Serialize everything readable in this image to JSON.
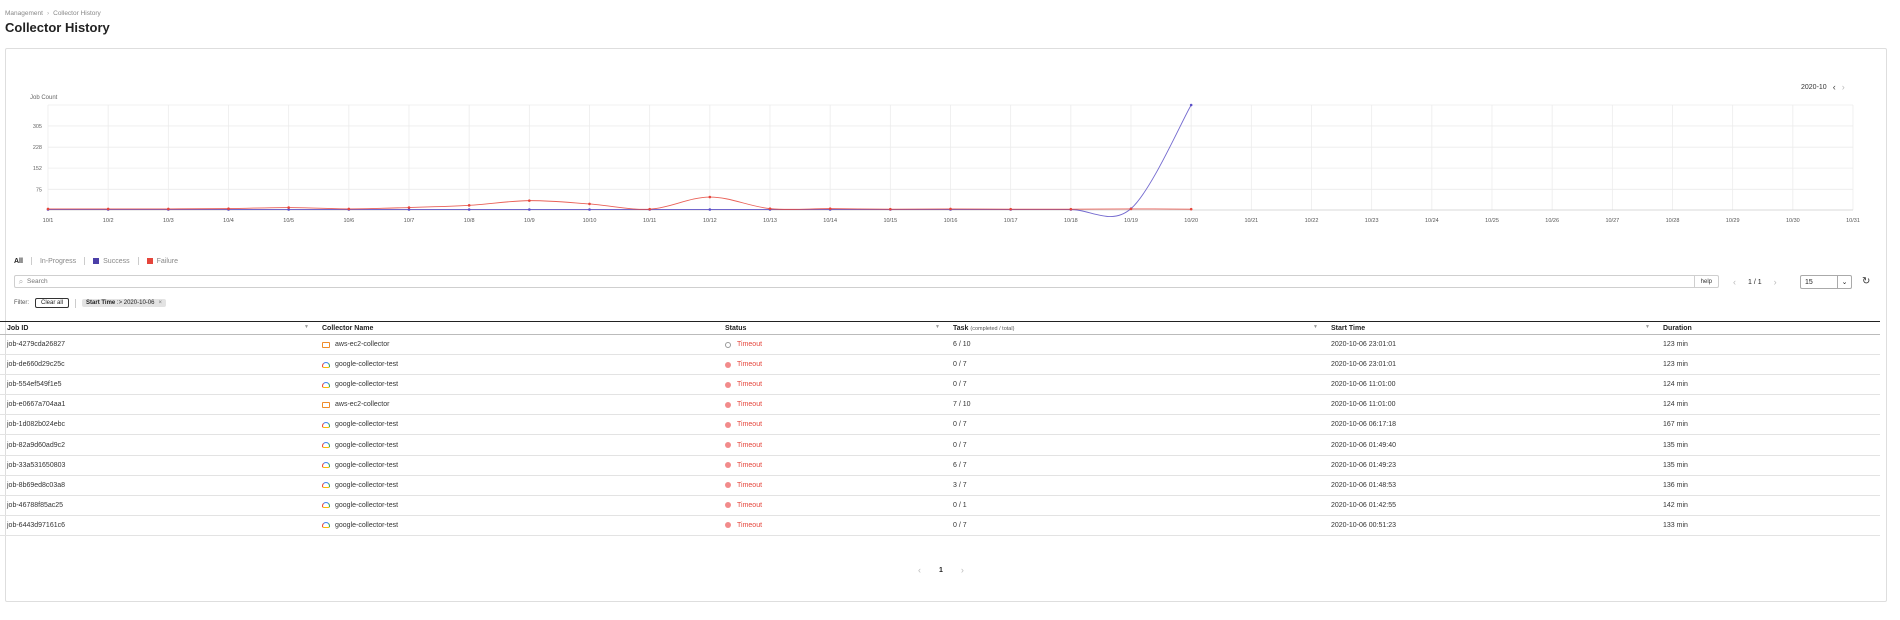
{
  "breadcrumb": [
    "Management",
    "Collector History"
  ],
  "page_title": "Collector History",
  "month_nav": {
    "label": "2020-10",
    "prev_icon": "chevron-left-icon",
    "next_icon": "chevron-right-icon"
  },
  "chart_data": {
    "type": "line",
    "ylabel": "Job Count",
    "yticks": [
      75,
      152,
      228,
      305
    ],
    "ylim": [
      0,
      381
    ],
    "x": [
      "10/1",
      "10/2",
      "10/3",
      "10/4",
      "10/5",
      "10/6",
      "10/7",
      "10/8",
      "10/9",
      "10/10",
      "10/11",
      "10/12",
      "10/13",
      "10/14",
      "10/15",
      "10/16",
      "10/17",
      "10/18",
      "10/19",
      "10/20",
      "10/21",
      "10/22",
      "10/23",
      "10/24",
      "10/25",
      "10/26",
      "10/27",
      "10/28",
      "10/29",
      "10/30",
      "10/31"
    ],
    "series": [
      {
        "key": "success",
        "color": "#5b4fc7",
        "values": [
          0,
          0,
          0,
          0,
          0,
          0,
          0,
          0,
          0,
          0,
          0,
          0,
          0,
          0,
          0,
          0,
          0,
          0,
          5,
          381
        ]
      },
      {
        "key": "failure",
        "color": "#e5453b",
        "values": [
          4,
          4,
          4,
          5,
          9,
          4,
          9,
          17,
          34,
          22,
          3,
          47,
          5,
          5,
          3,
          4,
          3,
          3,
          4,
          3
        ]
      }
    ],
    "grid": true
  },
  "legend": {
    "all": "All",
    "in_progress": "In-Progress",
    "success": "Success",
    "failure": "Failure",
    "success_color": "#4b3fa8",
    "failure_color": "#e5453b"
  },
  "search": {
    "placeholder": "Search",
    "help": "help",
    "icon": "search-icon"
  },
  "pager": {
    "page": "1 / 1",
    "page_size": "15",
    "current": "1"
  },
  "filter": {
    "label": "Filter:",
    "clear_all": "Clear all",
    "tag_key": "Start Time",
    "tag_value": ":> 2020-10-06"
  },
  "table": {
    "headers": {
      "job_id": "Job ID",
      "collector_name": "Collector Name",
      "status": "Status",
      "task": "Task",
      "task_sub": "(completed / total)",
      "start_time": "Start Time",
      "duration": "Duration"
    },
    "rows": [
      {
        "job_id": "job-4279cda26827",
        "provider": "aws",
        "collector": "aws-ec2-collector",
        "status": "Timeout",
        "task": "6 / 10",
        "start": "2020-10-06 23:01:01",
        "duration": "123 min"
      },
      {
        "job_id": "job-de660d29c25c",
        "provider": "google",
        "collector": "google-collector-test",
        "status": "Timeout",
        "task": "0 / 7",
        "start": "2020-10-06 23:01:01",
        "duration": "123 min"
      },
      {
        "job_id": "job-554ef549f1e5",
        "provider": "google",
        "collector": "google-collector-test",
        "status": "Timeout",
        "task": "0 / 7",
        "start": "2020-10-06 11:01:00",
        "duration": "124 min"
      },
      {
        "job_id": "job-e0667a704aa1",
        "provider": "aws",
        "collector": "aws-ec2-collector",
        "status": "Timeout",
        "task": "7 / 10",
        "start": "2020-10-06 11:01:00",
        "duration": "124 min"
      },
      {
        "job_id": "job-1d082b024ebc",
        "provider": "google",
        "collector": "google-collector-test",
        "status": "Timeout",
        "task": "0 / 7",
        "start": "2020-10-06 06:17:18",
        "duration": "167 min"
      },
      {
        "job_id": "job-82a9d60ad9c2",
        "provider": "google",
        "collector": "google-collector-test",
        "status": "Timeout",
        "task": "0 / 7",
        "start": "2020-10-06 01:49:40",
        "duration": "135 min"
      },
      {
        "job_id": "job-33a531650803",
        "provider": "google",
        "collector": "google-collector-test",
        "status": "Timeout",
        "task": "6 / 7",
        "start": "2020-10-06 01:49:23",
        "duration": "135 min"
      },
      {
        "job_id": "job-8b69ed8c03a8",
        "provider": "google",
        "collector": "google-collector-test",
        "status": "Timeout",
        "task": "3 / 7",
        "start": "2020-10-06 01:48:53",
        "duration": "136 min"
      },
      {
        "job_id": "job-46788f85ac25",
        "provider": "google",
        "collector": "google-collector-test",
        "status": "Timeout",
        "task": "0 / 1",
        "start": "2020-10-06 01:42:55",
        "duration": "142 min"
      },
      {
        "job_id": "job-6443d97161c6",
        "provider": "google",
        "collector": "google-collector-test",
        "status": "Timeout",
        "task": "0 / 7",
        "start": "2020-10-06 00:51:23",
        "duration": "133 min"
      }
    ]
  }
}
